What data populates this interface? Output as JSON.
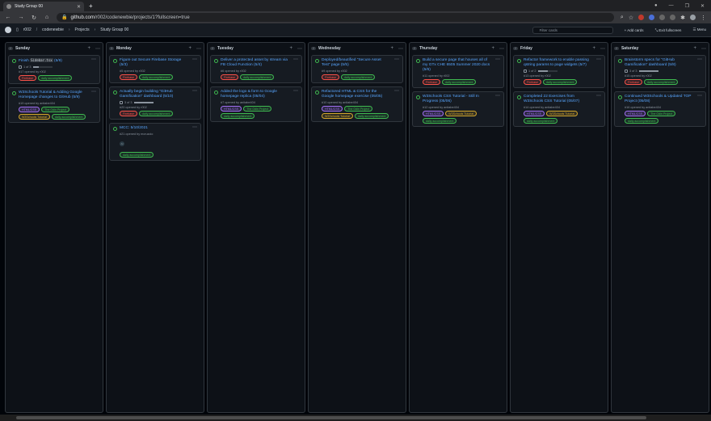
{
  "browser": {
    "tab_title": "Study Group 00",
    "url_host": "github.com",
    "url_path": "/r002/codenewbie/projects/1?fullscreen=true"
  },
  "header": {
    "crumbs": [
      "r002",
      "codenewbie",
      "Projects",
      "Study Group 00"
    ],
    "filter_placeholder": "Filter cards",
    "add_cards": "Add cards",
    "exit_fullscreen": "Exit fullscreen",
    "menu": "Menu"
  },
  "columns": [
    {
      "name": "Sunday",
      "count": "2",
      "cards": [
        {
          "title_pre": "Finish ",
          "code": "Sidebar.tsx",
          "title_post": " (5/9)",
          "progress": "1 of 3",
          "progress_frac": 0.33,
          "meta": "#17 opened by r002",
          "labels": [
            {
              "text": "Firebase",
              "c": "#f85149"
            },
            {
              "text": "daily accomplishment",
              "c": "#3fb950"
            }
          ]
        },
        {
          "title": "W3Schools Tutorial & Adding Google Homepage changes to GitHub (5/9)",
          "meta": "#19 opened by anitabe404",
          "labels": [
            {
              "text": "HTML/CSS",
              "c": "#a371f7"
            },
            {
              "text": "The Odin Project",
              "c": "#3fb950"
            },
            {
              "text": "W3Schools Tutorial",
              "c": "#d4a72c"
            },
            {
              "text": "daily accomplishment",
              "c": "#3fb950"
            }
          ]
        }
      ]
    },
    {
      "name": "Monday",
      "count": "3",
      "cards": [
        {
          "title": "Figure out Secure Firebase Storage (5/3)",
          "meta": "#5 opened by r002",
          "labels": [
            {
              "text": "Firebase",
              "c": "#f85149"
            },
            {
              "text": "daily accomplishment",
              "c": "#3fb950"
            }
          ]
        },
        {
          "title": "Actually begin building \"GitHub Gamification\" dashboard (5/10)",
          "progress": "3 of 3",
          "progress_frac": 1,
          "meta": "#20 opened by r002",
          "labels": [
            {
              "text": "Firebase",
              "c": "#f85149"
            },
            {
              "text": "daily accomplishment",
              "c": "#3fb950"
            }
          ]
        },
        {
          "title": "MCC: 5/10/2021",
          "meta": "#21 opened by mcruzcio",
          "avatar": "AI",
          "labels": [
            {
              "text": "daily accomplishment",
              "c": "#3fb950"
            }
          ]
        }
      ]
    },
    {
      "name": "Tuesday",
      "count": "2",
      "cards": [
        {
          "title": "Deliver a protected asset by stream via FB Cloud Function (5/4)",
          "meta": "#6 opened by r002",
          "labels": [
            {
              "text": "Firebase",
              "c": "#f85149"
            },
            {
              "text": "daily accomplishment",
              "c": "#3fb950"
            }
          ]
        },
        {
          "title": "Added the logo & form to Google homepage replica (05/04)",
          "meta": "#7 opened by anitabe404",
          "labels": [
            {
              "text": "HTML/CSS",
              "c": "#a371f7"
            },
            {
              "text": "The Odin Project",
              "c": "#3fb950"
            },
            {
              "text": "daily accomplishment",
              "c": "#3fb950"
            }
          ]
        }
      ]
    },
    {
      "name": "Wednesday",
      "count": "2",
      "cards": [
        {
          "title": "Deployed/beautified \"Secure Asset Test\" page (5/5)",
          "meta": "#9 opened by r002",
          "labels": [
            {
              "text": "Firebase",
              "c": "#f85149"
            },
            {
              "text": "daily accomplishment",
              "c": "#3fb950"
            }
          ]
        },
        {
          "title": "Refactored HTML & CSS for the Google homepage exercise (05/05)",
          "meta": "#10 opened by anitabe404",
          "labels": [
            {
              "text": "HTML/CSS",
              "c": "#a371f7"
            },
            {
              "text": "The Odin Project",
              "c": "#3fb950"
            },
            {
              "text": "W3Schools Tutorial",
              "c": "#d4a72c"
            },
            {
              "text": "daily accomplishment",
              "c": "#3fb950"
            }
          ]
        }
      ]
    },
    {
      "name": "Thursday",
      "count": "2",
      "cards": [
        {
          "title": "Build a secure page that houses all of my GTx CHE 6505 Summer 2020 docs (5/6)",
          "meta": "#11 opened by r002",
          "labels": [
            {
              "text": "Firebase",
              "c": "#f85149"
            },
            {
              "text": "daily accomplishment",
              "c": "#3fb950"
            }
          ]
        },
        {
          "title": "W3Schools CSS Tutorial - Still In Progress (05/06)",
          "meta": "#12 opened by anitabe404",
          "labels": [
            {
              "text": "HTML/CSS",
              "c": "#a371f7"
            },
            {
              "text": "W3Schools Tutorial",
              "c": "#d4a72c"
            },
            {
              "text": "daily accomplishment",
              "c": "#3fb950"
            }
          ]
        }
      ]
    },
    {
      "name": "Friday",
      "count": "2",
      "cards": [
        {
          "title": "Refactor framework to enable passing qstring params to page widgets (5/7)",
          "progress": "1 of 2",
          "progress_frac": 0.5,
          "meta": "#13 opened by r002",
          "labels": [
            {
              "text": "Firebase",
              "c": "#f85149"
            },
            {
              "text": "daily accomplishment",
              "c": "#3fb950"
            }
          ]
        },
        {
          "title": "Completed 22 Exercises from W3Schools CSS Tutorial (05/07)",
          "meta": "#14 opened by anitabe404",
          "labels": [
            {
              "text": "HTML/CSS",
              "c": "#a371f7"
            },
            {
              "text": "W3Schools Tutorial",
              "c": "#d4a72c"
            },
            {
              "text": "daily accomplishment",
              "c": "#3fb950"
            }
          ]
        }
      ]
    },
    {
      "name": "Saturday",
      "count": "2",
      "cards": [
        {
          "title": "Brainstorm specs for \"GitHub Gamification\" dashboard (5/8)",
          "progress": "3 of 3",
          "progress_frac": 1,
          "meta": "#15 opened by r002",
          "labels": [
            {
              "text": "Firebase",
              "c": "#f85149"
            },
            {
              "text": "daily accomplishment",
              "c": "#3fb950"
            }
          ]
        },
        {
          "title": "Continued W3Schools & Updated TOP Project (05/08)",
          "meta": "#16 opened by anitabe404",
          "labels": [
            {
              "text": "HTML/CSS",
              "c": "#a371f7"
            },
            {
              "text": "The Odin Project",
              "c": "#3fb950"
            },
            {
              "text": "daily accomplishment",
              "c": "#3fb950"
            }
          ]
        }
      ]
    }
  ]
}
